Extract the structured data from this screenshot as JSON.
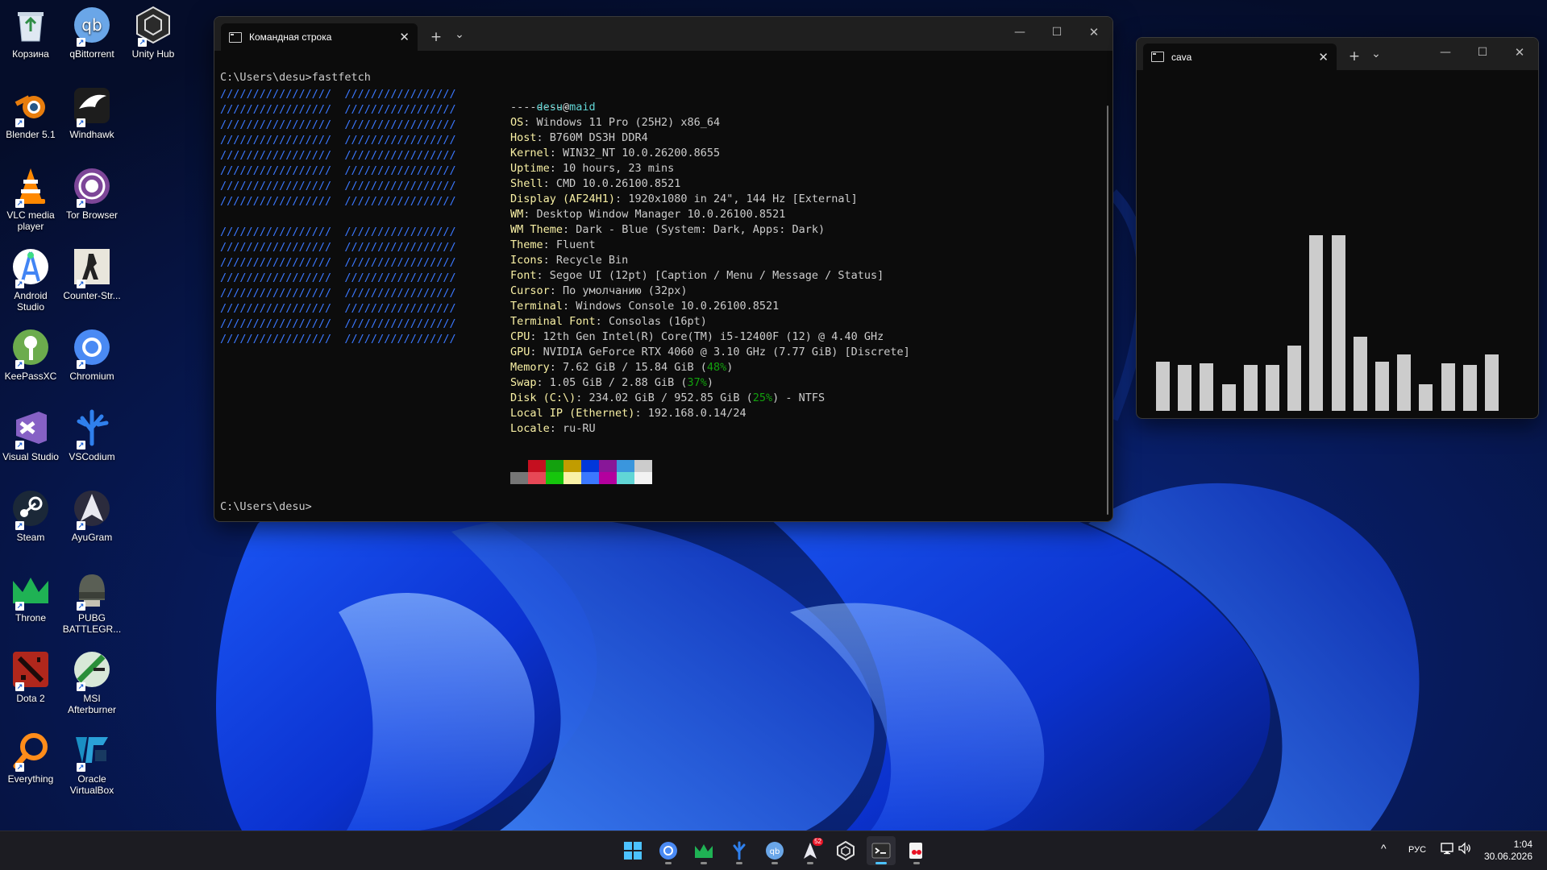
{
  "desktop": {
    "icons": [
      {
        "label": "Корзина",
        "icon": "recycle-bin-icon"
      },
      {
        "label": "qBittorrent",
        "icon": "qbittorrent-icon"
      },
      {
        "label": "Unity Hub",
        "icon": "unity-hub-icon"
      },
      {
        "label": "Blender 5.1",
        "icon": "blender-icon"
      },
      {
        "label": "Windhawk",
        "icon": "windhawk-icon"
      },
      {
        "label": "VLC media player",
        "icon": "vlc-icon"
      },
      {
        "label": "Tor Browser",
        "icon": "tor-browser-icon"
      },
      {
        "label": "Android Studio",
        "icon": "android-studio-icon"
      },
      {
        "label": "Counter-Str...",
        "icon": "counter-strike-icon"
      },
      {
        "label": "KeePassXC",
        "icon": "keepassxc-icon"
      },
      {
        "label": "Chromium",
        "icon": "chromium-icon"
      },
      {
        "label": "Visual Studio",
        "icon": "visual-studio-icon"
      },
      {
        "label": "VSCodium",
        "icon": "vscodium-icon"
      },
      {
        "label": "Steam",
        "icon": "steam-icon"
      },
      {
        "label": "AyuGram",
        "icon": "ayugram-icon"
      },
      {
        "label": "Throne",
        "icon": "throne-icon"
      },
      {
        "label": "PUBG BATTLEGR...",
        "icon": "pubg-icon"
      },
      {
        "label": "Dota 2",
        "icon": "dota2-icon"
      },
      {
        "label": "MSI Afterburner",
        "icon": "msi-afterburner-icon"
      },
      {
        "label": "Everything",
        "icon": "everything-icon"
      },
      {
        "label": "Oracle VirtualBox",
        "icon": "virtualbox-icon"
      }
    ]
  },
  "terminal": {
    "tab_title": "Командная строка",
    "new_tab": "+",
    "dropdown": "⌄",
    "prompt_command": "C:\\Users\\desu>fastfetch",
    "prompt_end": "C:\\Users\\desu>",
    "logo_block": "/////////////////  /////////////////",
    "user": "desu",
    "at": "@",
    "host": "maid",
    "separator": "---------",
    "info": [
      {
        "key": "OS",
        "value": "Windows 11 Pro (25H2) x86_64"
      },
      {
        "key": "Host",
        "value": "B760M DS3H DDR4"
      },
      {
        "key": "Kernel",
        "value": "WIN32_NT 10.0.26200.8655"
      },
      {
        "key": "Uptime",
        "value": "10 hours, 23 mins"
      },
      {
        "key": "Shell",
        "value": "CMD 10.0.26100.8521"
      },
      {
        "key": "Display (AF24H1)",
        "value": "1920x1080 in 24\", 144 Hz [External]"
      },
      {
        "key": "WM",
        "value": "Desktop Window Manager 10.0.26100.8521"
      },
      {
        "key": "WM Theme",
        "value": "Dark - Blue (System: Dark, Apps: Dark)"
      },
      {
        "key": "Theme",
        "value": "Fluent"
      },
      {
        "key": "Icons",
        "value": "Recycle Bin"
      },
      {
        "key": "Font",
        "value": "Segoe UI (12pt) [Caption / Menu / Message / Status]"
      },
      {
        "key": "Cursor",
        "value": "По умолчанию (32px)"
      },
      {
        "key": "Terminal",
        "value": "Windows Console 10.0.26100.8521"
      },
      {
        "key": "Terminal Font",
        "value": "Consolas (16pt)"
      },
      {
        "key": "CPU",
        "value": "12th Gen Intel(R) Core(TM) i5-12400F (12) @ 4.40 GHz"
      },
      {
        "key": "GPU",
        "value": "NVIDIA GeForce RTX 4060 @ 3.10 GHz (7.77 GiB) [Discrete]"
      },
      {
        "key": "Memory",
        "value": "7.62 GiB / 15.84 GiB (",
        "pct": "48%",
        "tail": ")"
      },
      {
        "key": "Swap",
        "value": "1.05 GiB / 2.88 GiB (",
        "pct": "37%",
        "tail": ")"
      },
      {
        "key": "Disk (C:\\)",
        "value": "234.02 GiB / 952.85 GiB (",
        "pct": "25%",
        "tail": ") - NTFS"
      },
      {
        "key": "Local IP (Ethernet)",
        "value": "192.168.0.14/24"
      },
      {
        "key": "Locale",
        "value": "ru-RU"
      }
    ],
    "palette_top": [
      "#0c0c0c",
      "#c50f1f",
      "#13a10e",
      "#c19c00",
      "#0037da",
      "#881798",
      "#3a96dd",
      "#cccccc"
    ],
    "palette_bottom": [
      "#767676",
      "#e74856",
      "#16c60c",
      "#f9f1a5",
      "#3b78ff",
      "#b4009e",
      "#61d6d6",
      "#f2f2f2"
    ]
  },
  "cava": {
    "tab_title": "cava",
    "new_tab": "+",
    "dropdown": "⌄",
    "bar_levels": [
      0.28,
      0.26,
      0.27,
      0.15,
      0.26,
      0.26,
      0.37,
      1.0,
      1.0,
      0.42,
      0.28,
      0.32,
      0.15,
      0.27,
      0.26,
      0.32
    ]
  },
  "taskbar": {
    "apps": [
      {
        "icon": "start-icon",
        "name": "Start",
        "active": false,
        "running": false
      },
      {
        "icon": "chromium-icon",
        "name": "Chromium",
        "active": false,
        "running": true
      },
      {
        "icon": "throne-icon",
        "name": "Throne",
        "active": false,
        "running": true
      },
      {
        "icon": "vscodium-icon",
        "name": "VSCodium",
        "active": false,
        "running": true
      },
      {
        "icon": "qbittorrent-icon",
        "name": "qBittorrent",
        "active": false,
        "running": true
      },
      {
        "icon": "ayugram-icon",
        "name": "AyuGram",
        "active": false,
        "running": true,
        "badge": "52"
      },
      {
        "icon": "unity-hub-icon",
        "name": "Unity Hub",
        "active": false,
        "running": false
      },
      {
        "icon": "terminal-icon",
        "name": "Terminal",
        "active": true,
        "running": true
      },
      {
        "icon": "snipping-tool-icon",
        "name": "Snipping Tool",
        "active": false,
        "running": true
      }
    ],
    "tray_chevron": "^",
    "language": "РУС",
    "time": "1:04",
    "date": "30.06.2026"
  }
}
